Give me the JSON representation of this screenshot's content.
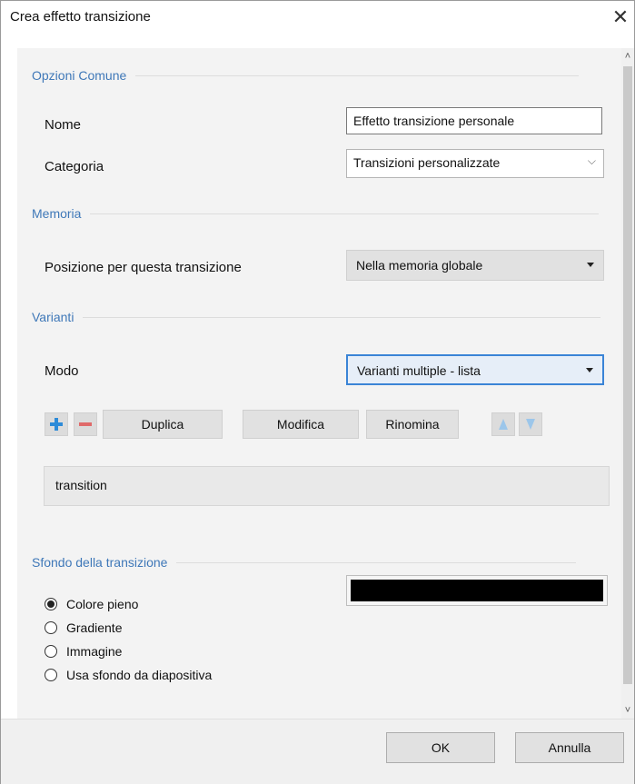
{
  "window": {
    "title": "Crea effetto transizione",
    "close_glyph": "✕"
  },
  "sections": {
    "common": "Opzioni Comune",
    "memory": "Memoria",
    "variants": "Varianti",
    "background": "Sfondo della transizione"
  },
  "common": {
    "name_label": "Nome",
    "name_value": "Effetto transizione personale",
    "category_label": "Categoria",
    "category_value": "Transizioni personalizzate"
  },
  "memory": {
    "position_label": "Posizione per questa transizione",
    "position_value": "Nella memoria globale"
  },
  "variants": {
    "mode_label": "Modo",
    "mode_value": "Varianti multiple - lista",
    "toolbar": {
      "add_icon": "plus-icon",
      "remove_icon": "minus-icon",
      "duplicate": "Duplica",
      "edit": "Modifica",
      "rename": "Rinomina",
      "move_up_icon": "arrow-up-icon",
      "move_down_icon": "arrow-down-icon"
    },
    "items": [
      "transition"
    ]
  },
  "background": {
    "options": [
      {
        "label": "Colore pieno",
        "checked": true
      },
      {
        "label": "Gradiente",
        "checked": false
      },
      {
        "label": "Immagine",
        "checked": false
      },
      {
        "label": "Usa sfondo da diapositiva",
        "checked": false
      }
    ],
    "color": "#000000"
  },
  "footer": {
    "ok": "OK",
    "cancel": "Annulla"
  },
  "colors": {
    "accent": "#3f78b8",
    "add_icon": "#2d8bd8",
    "remove_icon": "#e06a6a"
  }
}
